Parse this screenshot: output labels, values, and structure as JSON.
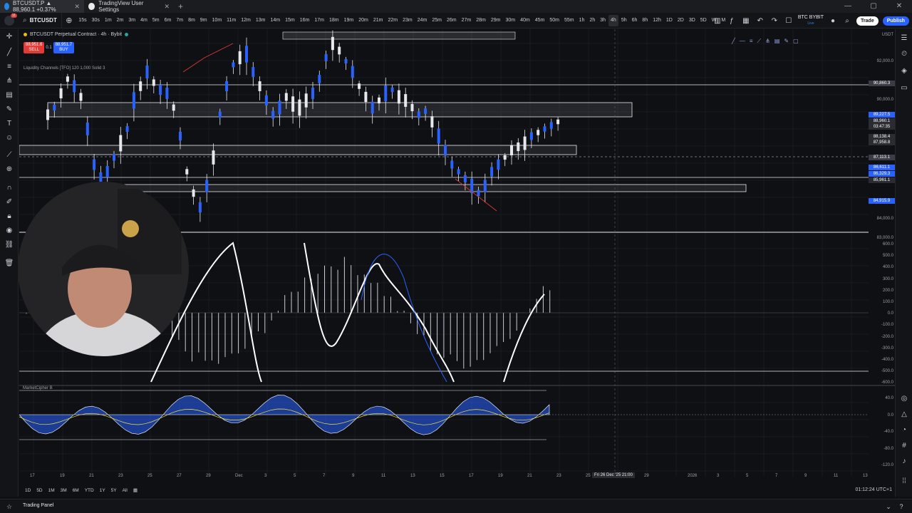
{
  "browser": {
    "tabs": [
      {
        "title": "BTCUSDT.P ▲ 88,960.1 +0.37%",
        "active": true
      },
      {
        "title": "TradingView User Settings",
        "active": false
      }
    ]
  },
  "toolbar": {
    "symbol": "BTCUSDT",
    "intervals": [
      "15s",
      "30s",
      "1m",
      "2m",
      "3m",
      "4m",
      "5m",
      "6m",
      "7m",
      "8m",
      "9m",
      "10m",
      "11m",
      "12m",
      "13m",
      "14m",
      "15m",
      "16m",
      "17m",
      "18m",
      "19m",
      "20m",
      "21m",
      "22m",
      "23m",
      "24m",
      "25m",
      "26m",
      "27m",
      "28m",
      "29m",
      "30m",
      "40m",
      "45m",
      "50m",
      "55m",
      "1h",
      "2h",
      "3h",
      "4h",
      "5h",
      "6h",
      "8h",
      "12h",
      "1D",
      "2D",
      "3D",
      "5D",
      "W",
      "M"
    ],
    "selected_interval": "4h",
    "broker_name": "BTC BYBIT",
    "broker_sub": "Live",
    "trade_label": "Trade",
    "publish_label": "Publish"
  },
  "legend": {
    "title": "BTCUSDT Perpetual Contract · 4h · Bybit",
    "sell_price": "88,951.6",
    "sell_label": "SELL",
    "spread": "0.1",
    "buy_price": "88,951.7",
    "buy_label": "BUY",
    "indicator": "Liquidity Channels [TFO] 120 1,000 Solid 3",
    "market_cipher": "MarketCipher B"
  },
  "price_axis": {
    "currency": "USDT",
    "labels": [
      "92,000.0",
      "90,000.0",
      "84,000.0",
      "83,000.0"
    ],
    "tags": [
      {
        "text": "90,860.3",
        "color": "#3a3d45"
      },
      {
        "text": "89,227.5",
        "color": "#2962ff"
      },
      {
        "text": "88,960.1",
        "color": "#2a2c32"
      },
      {
        "text": "03:47:35",
        "color": "#2a2c32"
      },
      {
        "text": "88,138.4",
        "color": "#2a2c32"
      },
      {
        "text": "87,958.8",
        "color": "#2a2c32"
      },
      {
        "text": "87,113.1",
        "color": "#3a3d45"
      },
      {
        "text": "86,611.1",
        "color": "#2962ff"
      },
      {
        "text": "86,329.3",
        "color": "#2962ff"
      },
      {
        "text": "85,961.1",
        "color": "#2a2c32"
      },
      {
        "text": "84,915.9",
        "color": "#2962ff"
      }
    ],
    "osc_labels": [
      "600.0",
      "500.0",
      "400.0",
      "300.0",
      "200.0",
      "100.0",
      "0.0",
      "-100.0",
      "-200.0",
      "-300.0",
      "-400.0",
      "-500.0",
      "-600.0"
    ],
    "mc_labels": [
      "40.0",
      "0.0",
      "-40.0",
      "-80.0",
      "-120.0"
    ]
  },
  "time_axis": {
    "labels": [
      "17",
      "19",
      "21",
      "23",
      "25",
      "27",
      "29",
      "Dec",
      "3",
      "5",
      "7",
      "9",
      "11",
      "13",
      "15",
      "17",
      "19",
      "21",
      "23",
      "25",
      "29",
      "2026",
      "3",
      "5",
      "7",
      "9",
      "11",
      "13"
    ],
    "crosshair": "Fri 26 Dec '25 21:00"
  },
  "ranges": [
    "1D",
    "5D",
    "1M",
    "3M",
    "6M",
    "YTD",
    "1Y",
    "5Y",
    "All"
  ],
  "clock": "01:12:24 UTC+1",
  "bottom": {
    "trading_panel": "Trading Panel"
  }
}
